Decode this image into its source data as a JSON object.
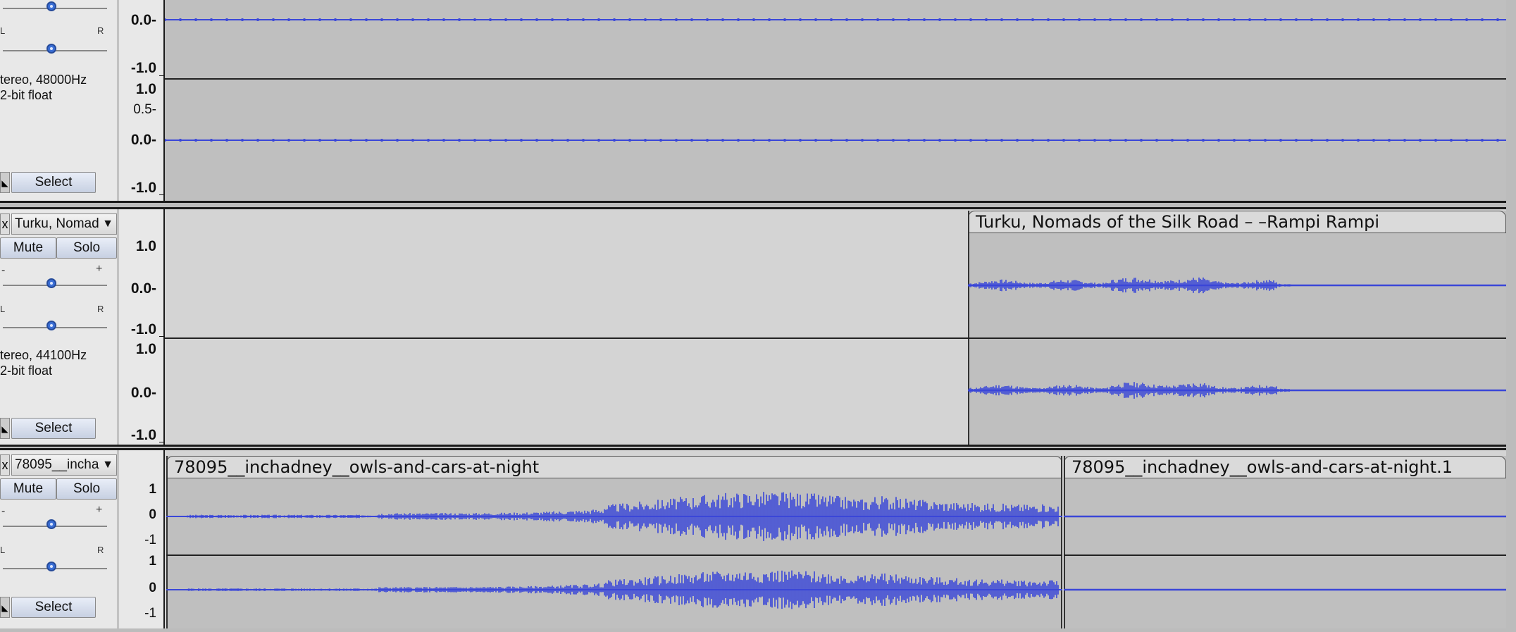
{
  "tracks": [
    {
      "info_line1": "tereo, 48000Hz",
      "info_line2": "2-bit float",
      "select_label": "Select",
      "slider_left": "L",
      "slider_right": "R",
      "ruler_ch1": [
        "0.0-",
        "-1.0"
      ],
      "ruler_ch2": [
        "1.0",
        "0.5-",
        "0.0-",
        "-1.0"
      ]
    },
    {
      "name": "Turku, Nomad",
      "mute_label": "Mute",
      "solo_label": "Solo",
      "gain_minus": "-",
      "gain_plus": "+",
      "slider_left": "L",
      "slider_right": "R",
      "info_line1": "tereo, 44100Hz",
      "info_line2": "2-bit float",
      "select_label": "Select",
      "ruler_ch1": [
        "1.0",
        "0.0-",
        "-1.0"
      ],
      "ruler_ch2": [
        "1.0",
        "0.0-",
        "-1.0"
      ],
      "clip_title": "Turku, Nomads of the Silk Road – –Rampi Rampi"
    },
    {
      "name": "78095__incha",
      "mute_label": "Mute",
      "solo_label": "Solo",
      "gain_minus": "-",
      "gain_plus": "+",
      "slider_left": "L",
      "slider_right": "R",
      "select_label": "Select",
      "ruler_ch1": [
        "1",
        "0",
        "-1"
      ],
      "ruler_ch2": [
        "1",
        "0",
        "-1"
      ],
      "clip1_title": "78095__inchadney__owls-and-cars-at-night",
      "clip2_title": "78095__inchadney__owls-and-cars-at-night.1"
    }
  ],
  "colors": {
    "waveform": "#3a47d8",
    "clip_bg": "#bfbfbf",
    "lane_bg": "#d4d4d4"
  },
  "icons": {
    "close": "close-icon",
    "dropdown": "triangle-down-icon",
    "collapse": "collapse-arrow-icon"
  }
}
